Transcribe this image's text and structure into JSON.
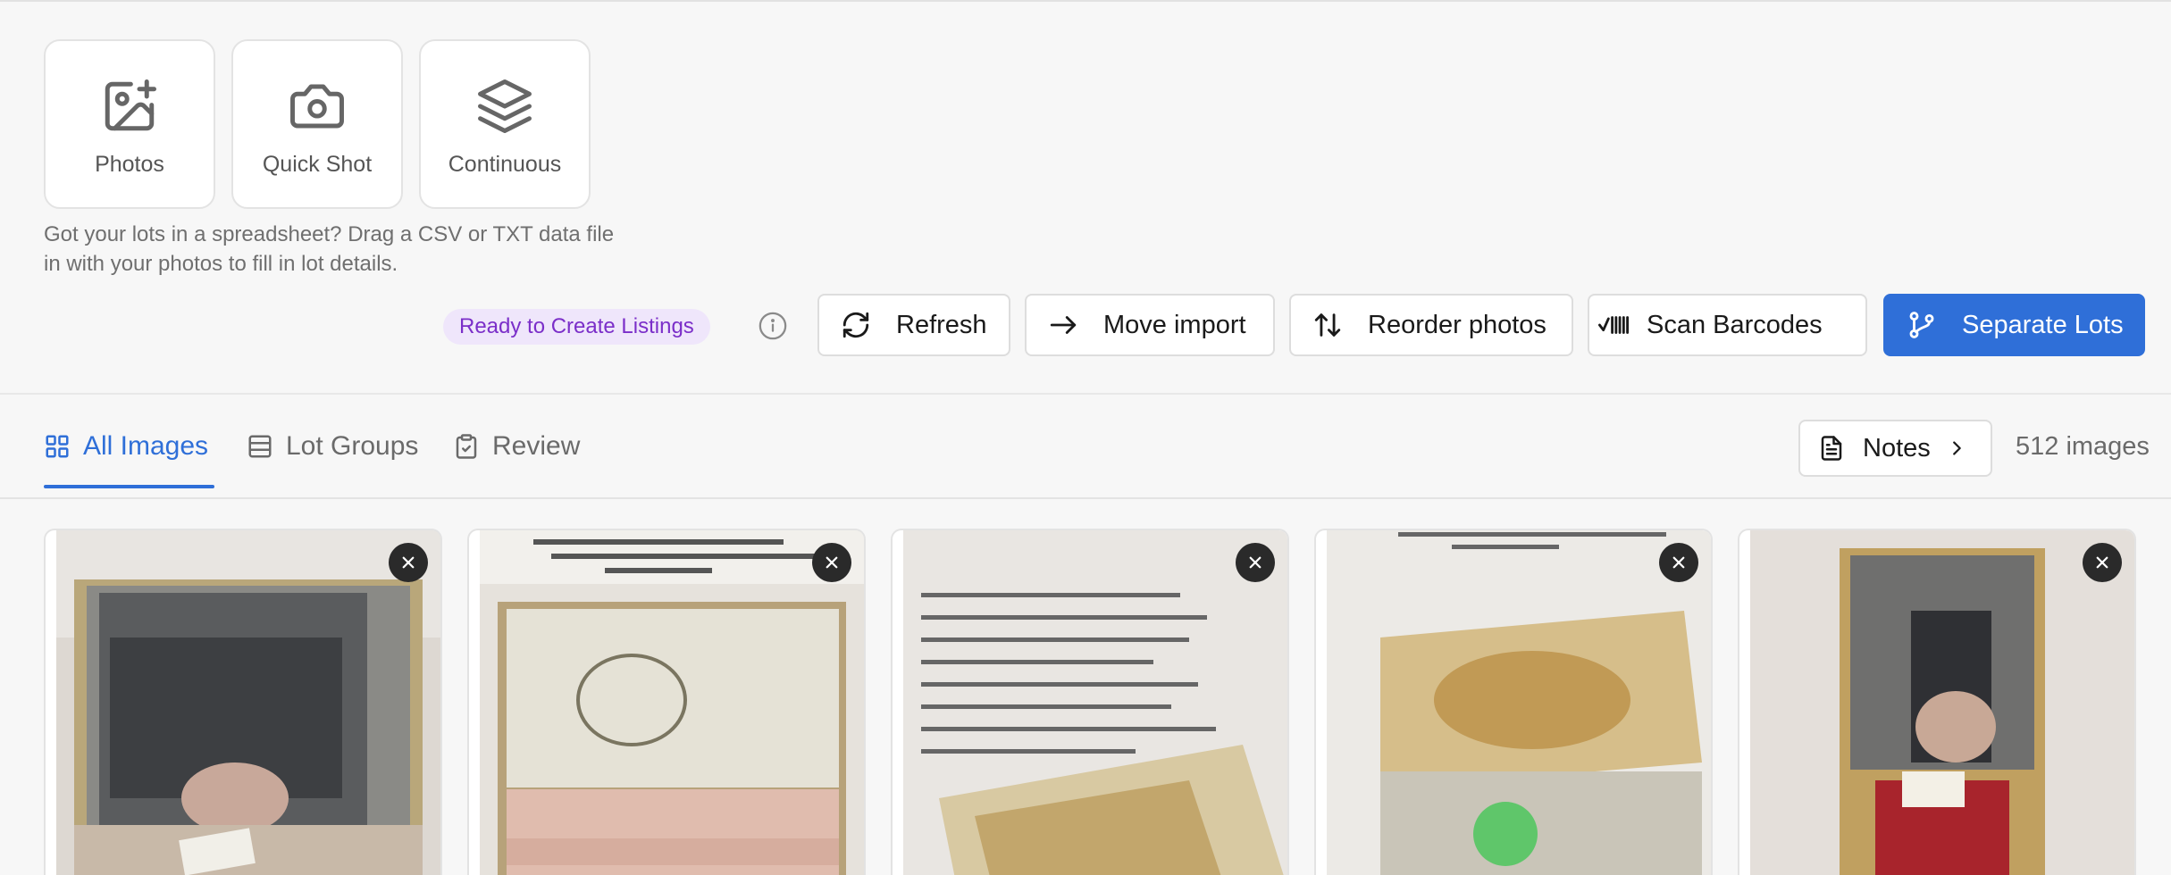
{
  "upload": {
    "tiles": [
      {
        "label": "Photos",
        "icon": "image-plus-icon"
      },
      {
        "label": "Quick Shot",
        "icon": "camera-icon"
      },
      {
        "label": "Continuous",
        "icon": "layers-icon"
      }
    ],
    "help_text": "Got your lots in a spreadsheet? Drag a CSV or TXT data file in with your photos to fill in lot details."
  },
  "actions": {
    "status_badge": "Ready to Create Listings",
    "refresh": "Refresh",
    "move_import": "Move import",
    "reorder_photos": "Reorder photos",
    "scan_barcodes": "Scan Barcodes",
    "separate_lots": "Separate Lots"
  },
  "tabs": [
    {
      "label": "All Images",
      "icon": "grid-icon",
      "active": true
    },
    {
      "label": "Lot Groups",
      "icon": "list-icon",
      "active": false
    },
    {
      "label": "Review",
      "icon": "clipboard-check-icon",
      "active": false
    }
  ],
  "notes_label": "Notes",
  "image_count": "512 images",
  "colors": {
    "primary": "#2f6fd8",
    "badge_bg": "#efe6fb",
    "badge_text": "#7b2fc9",
    "remove_btn": "#2a2a2a"
  },
  "images": [
    {
      "alt": "Open compact with mirror and price tag"
    },
    {
      "alt": "Open compact with pink powder puff"
    },
    {
      "alt": "Listing sheet with engraved compact lid"
    },
    {
      "alt": "Engraved compact lid with green sticker"
    },
    {
      "alt": "Open compact with mirror and red puffs"
    }
  ]
}
